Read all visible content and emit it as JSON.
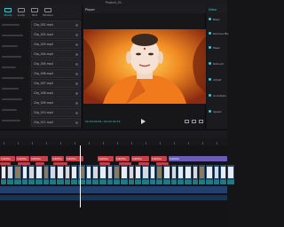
{
  "window": {
    "title": "Project_01"
  },
  "toolbar": {
    "items": [
      {
        "label": "Media",
        "icon": "media-icon"
      },
      {
        "label": "Audio",
        "icon": "audio-icon"
      },
      {
        "label": "Text",
        "icon": "text-icon"
      },
      {
        "label": "Stickers",
        "icon": "sticker-icon"
      }
    ]
  },
  "assets": [
    "Clip_001.mp4",
    "Clip_002.mp4",
    "Clip_003.mp4",
    "Clip_004.mp4",
    "Clip_005.mp4",
    "Clip_006.mp4",
    "Clip_007.mp4",
    "Clip_008.mp4",
    "Clip_009.mp4",
    "Clip_010.mp4",
    "Clip_011.mp4"
  ],
  "player": {
    "title": "Player",
    "timecode": "00:00:09:06 / 00:03:42:15"
  },
  "inspector": {
    "tab": "Video",
    "rows": [
      "Basic",
      "Remove BG",
      "Mask",
      "Retouch",
      "Adjust",
      "Animation",
      "Speed"
    ]
  },
  "timeline": {
    "text_track": [
      "Subtitle",
      "Subtitle",
      "Subtitle",
      "Subtitle",
      "Subtitle",
      "Subtitle",
      "Subtitle",
      "Subtitle",
      "Subtitle",
      "Subtitle"
    ],
    "effect_track": [
      "Effect",
      "Effect",
      "Effect",
      "Effect",
      "Effect",
      "Effect",
      "Effect",
      "Effect"
    ]
  },
  "colors": {
    "accent": "#2fd3d8",
    "clip_red": "#c6404a",
    "clip_teal": "#1f6f73",
    "clip_purple": "#6b5bb8",
    "audio": "#22406f"
  }
}
